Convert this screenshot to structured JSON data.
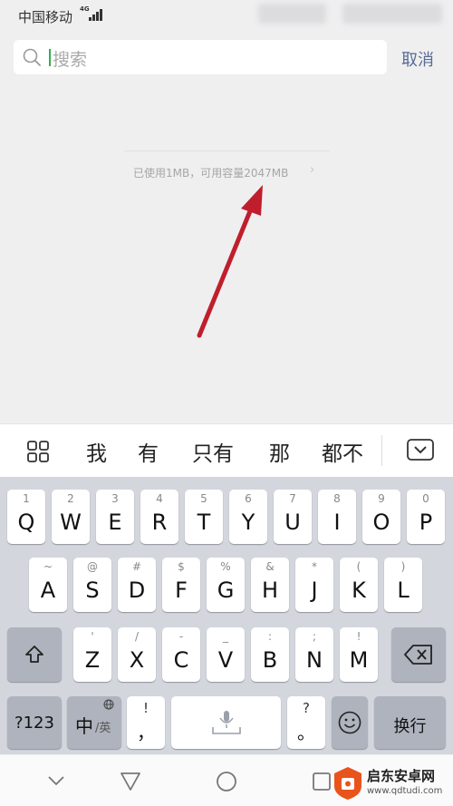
{
  "status_bar": {
    "carrier": "中国移动",
    "network": "4G"
  },
  "search": {
    "placeholder": "搜索",
    "cancel_label": "取消"
  },
  "storage": {
    "text": "已使用1MB，可用容量2047MB",
    "chevron": "›"
  },
  "candidates": [
    "我",
    "有",
    "只有",
    "那",
    "都不"
  ],
  "keyboard": {
    "row1": [
      {
        "hint": "1",
        "label": "Q"
      },
      {
        "hint": "2",
        "label": "W"
      },
      {
        "hint": "3",
        "label": "E"
      },
      {
        "hint": "4",
        "label": "R"
      },
      {
        "hint": "5",
        "label": "T"
      },
      {
        "hint": "6",
        "label": "Y"
      },
      {
        "hint": "7",
        "label": "U"
      },
      {
        "hint": "8",
        "label": "I"
      },
      {
        "hint": "9",
        "label": "O"
      },
      {
        "hint": "0",
        "label": "P"
      }
    ],
    "row2": [
      {
        "hint": "~",
        "label": "A"
      },
      {
        "hint": "@",
        "label": "S"
      },
      {
        "hint": "#",
        "label": "D"
      },
      {
        "hint": "$",
        "label": "F"
      },
      {
        "hint": "%",
        "label": "G"
      },
      {
        "hint": "&",
        "label": "H"
      },
      {
        "hint": "*",
        "label": "J"
      },
      {
        "hint": "(",
        "label": "K"
      },
      {
        "hint": ")",
        "label": "L"
      }
    ],
    "row3": [
      {
        "hint": "'",
        "label": "Z"
      },
      {
        "hint": "/",
        "label": "X"
      },
      {
        "hint": "-",
        "label": "C"
      },
      {
        "hint": "_",
        "label": "V"
      },
      {
        "hint": ":",
        "label": "B"
      },
      {
        "hint": ";",
        "label": "N"
      },
      {
        "hint": "!",
        "label": "M"
      }
    ],
    "num_label": "?123",
    "lang_label_main": "中",
    "lang_label_alt": "/英",
    "punct_top": "!",
    "punct_bottom": "，",
    "punct2_top": "?",
    "punct2_bottom": "。",
    "enter_label": "换行"
  },
  "watermark": {
    "title": "启东安卓网",
    "url": "www.qdtudi.com"
  },
  "colors": {
    "accent_green": "#2bb24c",
    "link_blue": "#576b95",
    "arrow_red": "#c01e2c"
  }
}
